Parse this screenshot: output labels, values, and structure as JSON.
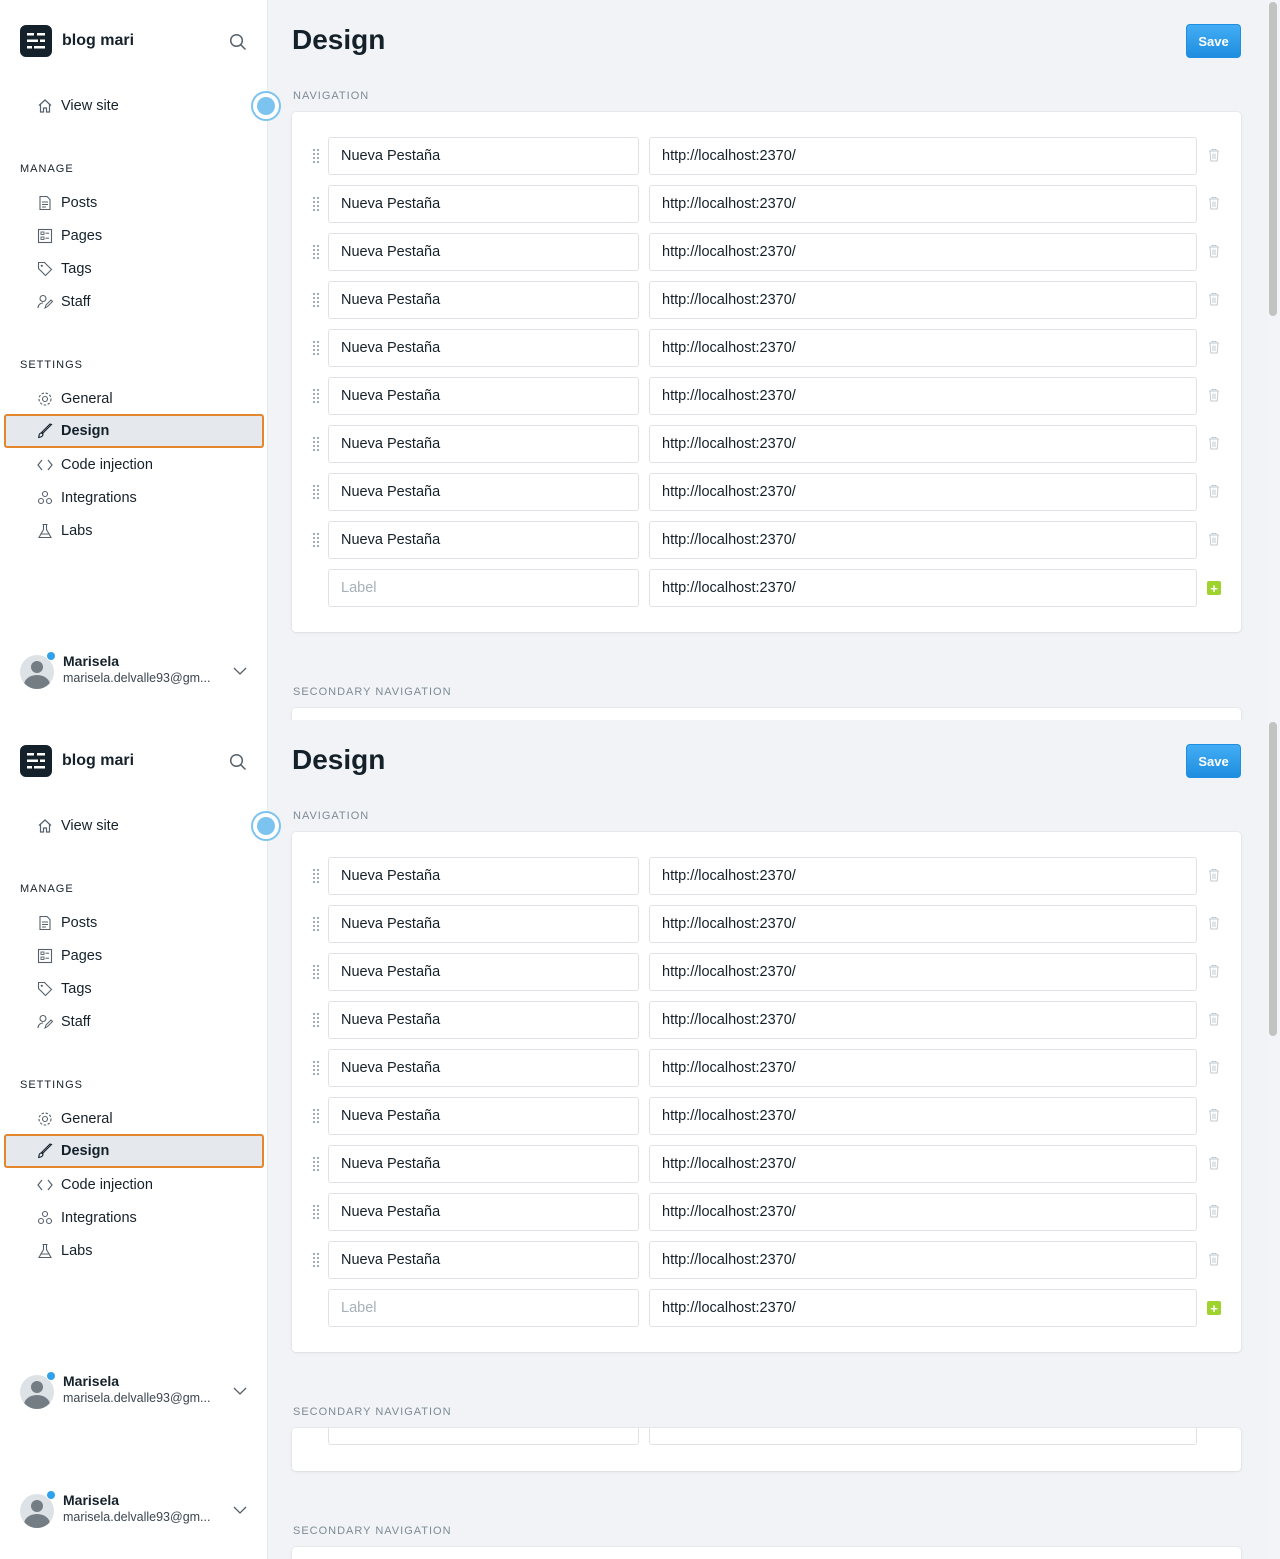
{
  "brand": {
    "name": "blog mari"
  },
  "sidebar": {
    "view_site": "View site",
    "manage_title": "MANAGE",
    "manage": [
      {
        "label": "Posts",
        "icon": "posts-icon"
      },
      {
        "label": "Pages",
        "icon": "pages-icon"
      },
      {
        "label": "Tags",
        "icon": "tag-icon"
      },
      {
        "label": "Staff",
        "icon": "staff-icon"
      }
    ],
    "settings_title": "SETTINGS",
    "settings": [
      {
        "label": "General",
        "icon": "gear-icon"
      },
      {
        "label": "Design",
        "icon": "brush-icon",
        "active": true
      },
      {
        "label": "Code injection",
        "icon": "code-icon"
      },
      {
        "label": "Integrations",
        "icon": "integrations-icon"
      },
      {
        "label": "Labs",
        "icon": "flask-icon"
      }
    ]
  },
  "user": {
    "name": "Marisela",
    "email": "marisela.delvalle93@gm..."
  },
  "page": {
    "title": "Design",
    "save_label": "Save"
  },
  "navigation": {
    "section_title": "NAVIGATION",
    "items": [
      {
        "label": "Nueva Pestaña",
        "url": "http://localhost:2370/"
      },
      {
        "label": "Nueva Pestaña",
        "url": "http://localhost:2370/"
      },
      {
        "label": "Nueva Pestaña",
        "url": "http://localhost:2370/"
      },
      {
        "label": "Nueva Pestaña",
        "url": "http://localhost:2370/"
      },
      {
        "label": "Nueva Pestaña",
        "url": "http://localhost:2370/"
      },
      {
        "label": "Nueva Pestaña",
        "url": "http://localhost:2370/"
      },
      {
        "label": "Nueva Pestaña",
        "url": "http://localhost:2370/"
      },
      {
        "label": "Nueva Pestaña",
        "url": "http://localhost:2370/"
      },
      {
        "label": "Nueva Pestaña",
        "url": "http://localhost:2370/"
      }
    ],
    "new_item": {
      "label_placeholder": "Label",
      "url": "http://localhost:2370/"
    }
  },
  "secondary_navigation": {
    "section_title": "SECONDARY NAVIGATION"
  },
  "colors": {
    "accent": "#30a2ec",
    "active_outline": "#e4862b",
    "add": "#9fd22c"
  }
}
